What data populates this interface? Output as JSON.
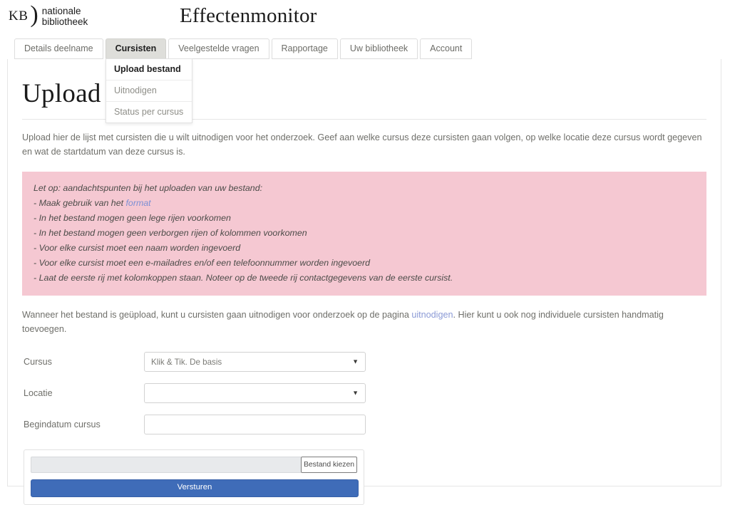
{
  "header": {
    "logo": {
      "mark": "KB",
      "slash": ")",
      "line1": "nationale",
      "line2": "bibliotheek"
    },
    "app_title": "Effectenmonitor"
  },
  "tabs": [
    {
      "label": "Details deelname",
      "active": false
    },
    {
      "label": "Cursisten",
      "active": true
    },
    {
      "label": "Veelgestelde vragen",
      "active": false
    },
    {
      "label": "Rapportage",
      "active": false
    },
    {
      "label": "Uw bibliotheek",
      "active": false
    },
    {
      "label": "Account",
      "active": false
    }
  ],
  "dropdown": {
    "items": [
      {
        "label": "Upload bestand",
        "current": true
      },
      {
        "label": "Uitnodigen",
        "current": false
      },
      {
        "label": "Status per cursus",
        "current": false
      }
    ]
  },
  "main": {
    "page_title": "Upload bestand",
    "intro": "Upload hier de lijst met cursisten die u wilt uitnodigen voor het onderzoek. Geef aan welke cursus deze cursisten gaan volgen, op welke locatie deze cursus wordt gegeven en wat de startdatum van deze cursus is."
  },
  "alert": {
    "heading": "Let op: aandachtspunten bij het uploaden van uw bestand:",
    "line_format_prefix": "- Maak gebruik van het ",
    "line_format_link": "format",
    "lines": [
      "- In het bestand mogen geen lege rijen voorkomen",
      "- In het bestand mogen geen verborgen rijen of kolommen voorkomen",
      "- Voor elke cursist moet een naam worden ingevoerd",
      "- Voor elke cursist moet een e-mailadres en/of een telefoonnummer worden ingevoerd",
      "- Laat de eerste rij met kolomkoppen staan. Noteer op de tweede rij contactgegevens van de eerste cursist."
    ]
  },
  "after_note": {
    "part1": "Wanneer het bestand is geüpload, kunt u cursisten gaan uitnodigen voor onderzoek op de pagina ",
    "link": "uitnodigen",
    "part2": ". Hier kunt u ook nog individuele cursisten handmatig toevoegen."
  },
  "form": {
    "cursus_label": "Cursus",
    "cursus_value": "Klik & Tik. De basis",
    "locatie_label": "Locatie",
    "locatie_value": "",
    "begindatum_label": "Begindatum cursus",
    "begindatum_value": "",
    "arrow_glyph": "▼"
  },
  "upload": {
    "file_button_label": "Bestand kiezen",
    "file_name": "",
    "submit_label": "Versturen"
  },
  "colors": {
    "alert_bg": "#f5c8d2",
    "submit_bg": "#3f6cb8",
    "active_tab_bg": "#dededa",
    "link": "#7b8fd4"
  }
}
